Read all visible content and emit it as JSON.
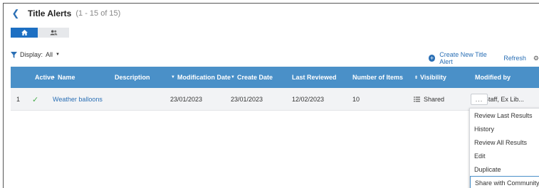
{
  "header": {
    "title": "Title Alerts",
    "count": "(1 - 15 of 15)"
  },
  "tabs": [
    {
      "name": "home",
      "icon": "home-icon",
      "active": true
    },
    {
      "name": "community",
      "icon": "users-icon",
      "active": false
    }
  ],
  "filter": {
    "label": "Display:",
    "value": "All"
  },
  "actions": {
    "create_label": "Create New Title Alert",
    "refresh_label": "Refresh"
  },
  "table": {
    "columns": {
      "active": "Active",
      "name": "Name",
      "description": "Description",
      "modification_date": "Modification Date",
      "create_date": "Create Date",
      "last_reviewed": "Last Reviewed",
      "number_of_items": "Number of Items",
      "visibility": "Visibility",
      "modified_by": "Modified by"
    },
    "rows": [
      {
        "index": "1",
        "active": true,
        "name": "Weather balloons",
        "description": "",
        "modification_date": "23/01/2023",
        "create_date": "23/01/2023",
        "last_reviewed": "12/02/2023",
        "number_of_items": "10",
        "visibility": "Shared",
        "modified_by": "Staff, Ex Lib..."
      }
    ]
  },
  "row_menu": {
    "more_label": "...",
    "items": [
      "Review Last Results",
      "History",
      "Review All Results",
      "Edit",
      "Duplicate",
      "Share with Community"
    ],
    "highlighted_index": 5
  },
  "colors": {
    "header_bg": "#4a90c8",
    "link": "#2a6fb5",
    "tab_active": "#1d6fc2",
    "check": "#4caf50"
  }
}
